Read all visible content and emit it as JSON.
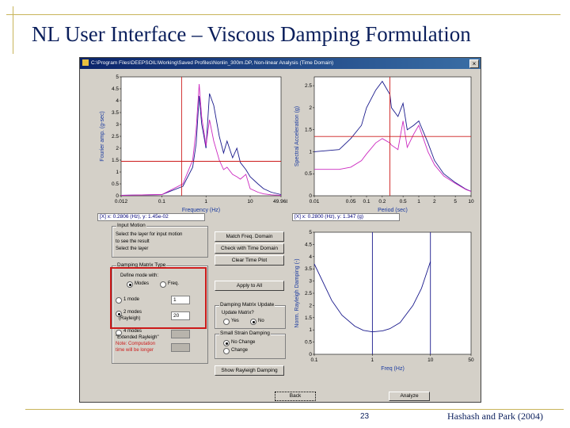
{
  "slide": {
    "title": "NL User Interface – Viscous Damping Formulation",
    "page_number": "23",
    "citation": "Hashash and Park (2004)"
  },
  "window": {
    "title": "C:\\Program Files\\DEEPSOIL\\Working\\Saved Profiles\\Nonlin_300m.DP, Non-linear Analysis (Time Domain)",
    "close_glyph": "×"
  },
  "plots": {
    "fourier": {
      "ylabel": "Fourier amp. (g-sec)",
      "xlabel": "Frequency (Hz)",
      "readout": "[X] x: 0.2806 (Hz), y: 1.45e-02",
      "y_ticks": [
        "5",
        "4.5",
        "4",
        "3.5",
        "3",
        "2.5",
        "2",
        "1.5",
        "1",
        "0.5",
        "0"
      ],
      "x_ticks": [
        "0.012",
        "0.1",
        "1",
        "10",
        "49.968"
      ]
    },
    "spectral": {
      "ylabel": "Spectral Acceleration (g)",
      "xlabel": "Period (sec)",
      "readout": "[X] x: 0.2800 (Hz), y: 1.347 (g)",
      "y_ticks": [
        "2.5",
        "2",
        "1.5",
        "1",
        "0.5",
        "0"
      ],
      "x_ticks": [
        "0.01",
        "0.05",
        "0.1",
        "0.2",
        "0.5",
        "1",
        "2",
        "5",
        "10"
      ]
    },
    "damping": {
      "ylabel": "Norm. Rayleigh Damping (-)",
      "xlabel": "Freq (Hz)",
      "y_ticks": [
        "5",
        "4.5",
        "4",
        "3.5",
        "3",
        "2.5",
        "2",
        "1.5",
        "1",
        "0.5",
        "0"
      ],
      "x_ticks": [
        "0.1",
        "1",
        "10",
        "50"
      ]
    }
  },
  "controls": {
    "layer_group": {
      "label": "Input Motion",
      "lines": [
        "Select the layer for input motion",
        "to see the result",
        "Select the layer"
      ]
    },
    "damping_group": {
      "label": "Damping Matrix Type",
      "define_label": "Define mode with:",
      "modes_label": "Modes",
      "freq_label": "Freq.",
      "one_mode_label": "1 mode",
      "one_mode_value": "1",
      "two_modes_label": "2 modes",
      "two_modes_sub": "(Rayleigh)",
      "two_modes_value": "20",
      "four_modes_label": "4 modes",
      "extended_label": "\"Extended Rayleigh\"",
      "warning_line1": "Note: Computation",
      "warning_line2": "time will be longer"
    },
    "buttons": {
      "match_freq": "Match Freq. Domain",
      "check_time": "Check with Time Domain",
      "clear_time": "Clear Time Plot",
      "apply_to_all": "Apply to All",
      "show_rayleigh": "Show Rayleigh Damping",
      "back": "Back",
      "analyze": "Analyze"
    },
    "update_group": {
      "label": "Damping Matrix Update",
      "line1": "Update Matrix?",
      "yes_label": "Yes",
      "no_label": "No"
    },
    "strain_group": {
      "label": "Small Strain Damping",
      "no_change_label": "No Change",
      "change_label": "Change"
    }
  },
  "chart_data": [
    {
      "type": "line",
      "title": "",
      "xlabel": "Frequency (Hz)",
      "ylabel": "Fourier amp. (g-sec)",
      "xscale": "log",
      "xlim": [
        0.012,
        49.968
      ],
      "ylim": [
        0,
        5
      ],
      "grid": false,
      "series": [
        {
          "color": "#1a1a8c",
          "x": [
            0.012,
            0.1,
            0.3,
            0.5,
            0.6,
            0.7,
            0.8,
            0.9,
            1.0,
            1.2,
            1.5,
            2,
            2.5,
            3,
            4,
            5,
            6,
            8,
            10,
            15,
            20,
            30,
            49.968
          ],
          "values": [
            0.02,
            0.05,
            0.4,
            1.2,
            2.2,
            4.2,
            3.0,
            2.5,
            2.0,
            4.3,
            3.8,
            2.5,
            1.8,
            2.3,
            1.6,
            2.0,
            1.4,
            1.1,
            0.8,
            0.5,
            0.3,
            0.15,
            0.05
          ]
        },
        {
          "color": "#cc2ac0",
          "x": [
            0.012,
            0.1,
            0.3,
            0.5,
            0.6,
            0.7,
            0.8,
            0.9,
            1.0,
            1.2,
            1.5,
            2,
            2.5,
            3,
            4,
            5,
            6,
            8,
            10,
            15,
            20,
            30,
            49.968
          ],
          "values": [
            0.02,
            0.05,
            0.5,
            1.5,
            2.8,
            4.7,
            3.3,
            2.7,
            2.1,
            3.2,
            2.3,
            1.5,
            1.1,
            1.2,
            0.9,
            0.8,
            0.7,
            0.9,
            0.3,
            0.15,
            0.08,
            0.04,
            0.02
          ]
        },
        {
          "color": "#cc1a1a",
          "x": [
            0.012,
            49.968
          ],
          "values": [
            1.45,
            1.45
          ]
        }
      ],
      "marker_x": 0.2806
    },
    {
      "type": "line",
      "title": "",
      "xlabel": "Period (sec)",
      "ylabel": "Spectral Acceleration (g)",
      "xscale": "log",
      "xlim": [
        0.01,
        10
      ],
      "ylim": [
        0,
        2.7
      ],
      "grid": false,
      "series": [
        {
          "color": "#1a1a8c",
          "x": [
            0.01,
            0.03,
            0.05,
            0.08,
            0.1,
            0.15,
            0.2,
            0.28,
            0.3,
            0.4,
            0.5,
            0.6,
            0.8,
            1,
            1.5,
            2,
            3,
            5,
            8,
            10
          ],
          "values": [
            1.0,
            1.05,
            1.3,
            1.6,
            2.0,
            2.4,
            2.6,
            2.3,
            2.0,
            1.8,
            2.1,
            1.5,
            1.6,
            1.7,
            1.2,
            0.8,
            0.5,
            0.3,
            0.15,
            0.1
          ]
        },
        {
          "color": "#cc2ac0",
          "x": [
            0.01,
            0.03,
            0.05,
            0.08,
            0.1,
            0.15,
            0.2,
            0.28,
            0.3,
            0.4,
            0.5,
            0.6,
            0.8,
            1,
            1.5,
            2,
            3,
            5,
            8,
            10
          ],
          "values": [
            0.6,
            0.6,
            0.65,
            0.8,
            0.95,
            1.2,
            1.3,
            1.2,
            1.15,
            1.05,
            1.7,
            1.1,
            1.4,
            1.6,
            1.0,
            0.7,
            0.45,
            0.28,
            0.14,
            0.1
          ]
        },
        {
          "color": "#cc1a1a",
          "x": [
            0.01,
            10
          ],
          "values": [
            1.347,
            1.347
          ]
        }
      ],
      "marker_x": 0.28
    },
    {
      "type": "line",
      "title": "",
      "xlabel": "Freq (Hz)",
      "ylabel": "Norm. Rayleigh Damping (-)",
      "xscale": "log",
      "xlim": [
        0.1,
        50
      ],
      "ylim": [
        0,
        5
      ],
      "grid": false,
      "series": [
        {
          "color": "#1a1a8c",
          "x": [
            0.1,
            0.2,
            0.3,
            0.5,
            0.7,
            1,
            1.5,
            2,
            3,
            5,
            7,
            10
          ],
          "values": [
            3.7,
            2.2,
            1.6,
            1.15,
            0.98,
            0.92,
            0.96,
            1.05,
            1.3,
            2.0,
            2.7,
            3.8
          ]
        },
        {
          "color": "#1a1a8c",
          "x": [
            1,
            1
          ],
          "values": [
            0,
            5
          ]
        },
        {
          "color": "#1a1a8c",
          "x": [
            10,
            10
          ],
          "values": [
            0,
            5
          ]
        }
      ]
    }
  ]
}
